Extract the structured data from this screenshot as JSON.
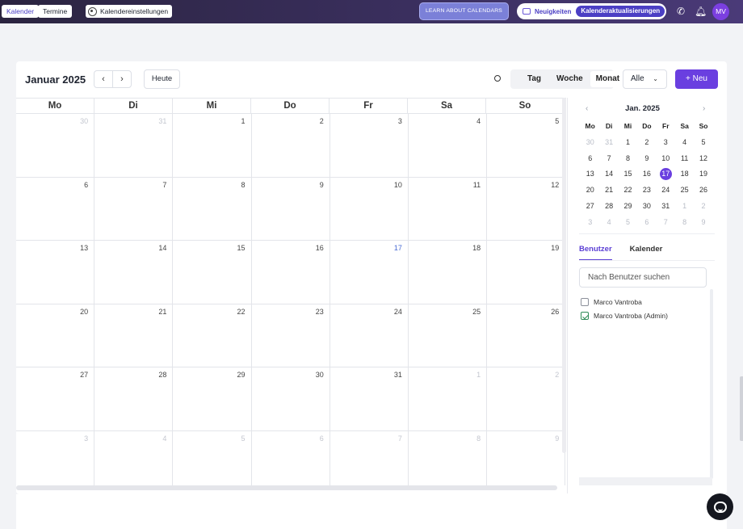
{
  "topbar": {
    "tabs": [
      {
        "label": "Kalender",
        "active": true
      },
      {
        "label": "Termine",
        "active": false
      }
    ],
    "settings_label": "Kalendereinstellungen",
    "learn_label": "LEARN ABOUT CALENDARS",
    "news_label": "Neuigkeiten",
    "updates_label": "Kalenderaktualisierungen",
    "avatar_initials": "MV",
    "icons": [
      "gear-icon",
      "megaphone-icon",
      "phone-icon",
      "bell-icon"
    ]
  },
  "toolbar": {
    "month_title": "Januar 2025",
    "prev_label": "‹",
    "next_label": "›",
    "today_label": "Heute",
    "views": [
      "Tag",
      "Woche",
      "Monat"
    ],
    "active_view": "Monat",
    "filter_value": "Alle",
    "new_label": "+ Neu"
  },
  "calendar": {
    "weekdays": [
      "Mo",
      "Di",
      "Mi",
      "Do",
      "Fr",
      "Sa",
      "So"
    ],
    "weeks": [
      [
        {
          "d": "30",
          "m": true
        },
        {
          "d": "31",
          "m": true
        },
        {
          "d": "1"
        },
        {
          "d": "2"
        },
        {
          "d": "3"
        },
        {
          "d": "4"
        },
        {
          "d": "5"
        }
      ],
      [
        {
          "d": "6"
        },
        {
          "d": "7"
        },
        {
          "d": "8"
        },
        {
          "d": "9"
        },
        {
          "d": "10"
        },
        {
          "d": "11"
        },
        {
          "d": "12"
        }
      ],
      [
        {
          "d": "13"
        },
        {
          "d": "14"
        },
        {
          "d": "15"
        },
        {
          "d": "16"
        },
        {
          "d": "17",
          "today": true
        },
        {
          "d": "18"
        },
        {
          "d": "19"
        }
      ],
      [
        {
          "d": "20"
        },
        {
          "d": "21"
        },
        {
          "d": "22"
        },
        {
          "d": "23"
        },
        {
          "d": "24"
        },
        {
          "d": "25"
        },
        {
          "d": "26"
        }
      ],
      [
        {
          "d": "27"
        },
        {
          "d": "28"
        },
        {
          "d": "29"
        },
        {
          "d": "30"
        },
        {
          "d": "31"
        },
        {
          "d": "1",
          "m": true
        },
        {
          "d": "2",
          "m": true
        }
      ],
      [
        {
          "d": "3",
          "m": true
        },
        {
          "d": "4",
          "m": true
        },
        {
          "d": "5",
          "m": true
        },
        {
          "d": "6",
          "m": true
        },
        {
          "d": "7",
          "m": true
        },
        {
          "d": "8",
          "m": true
        },
        {
          "d": "9",
          "m": true
        }
      ]
    ]
  },
  "mini_calendar": {
    "title": "Jan. 2025",
    "prev_label": "‹",
    "next_label": "›",
    "weekdays": [
      "Mo",
      "Di",
      "Mi",
      "Do",
      "Fr",
      "Sa",
      "So"
    ],
    "weeks": [
      [
        {
          "d": "30",
          "m": true
        },
        {
          "d": "31",
          "m": true
        },
        {
          "d": "1"
        },
        {
          "d": "2"
        },
        {
          "d": "3"
        },
        {
          "d": "4"
        },
        {
          "d": "5"
        }
      ],
      [
        {
          "d": "6"
        },
        {
          "d": "7"
        },
        {
          "d": "8"
        },
        {
          "d": "9"
        },
        {
          "d": "10"
        },
        {
          "d": "11"
        },
        {
          "d": "12"
        }
      ],
      [
        {
          "d": "13"
        },
        {
          "d": "14"
        },
        {
          "d": "15"
        },
        {
          "d": "16"
        },
        {
          "d": "17",
          "sel": true
        },
        {
          "d": "18"
        },
        {
          "d": "19"
        }
      ],
      [
        {
          "d": "20"
        },
        {
          "d": "21"
        },
        {
          "d": "22"
        },
        {
          "d": "23"
        },
        {
          "d": "24"
        },
        {
          "d": "25"
        },
        {
          "d": "26"
        }
      ],
      [
        {
          "d": "27"
        },
        {
          "d": "28"
        },
        {
          "d": "29"
        },
        {
          "d": "30"
        },
        {
          "d": "31"
        },
        {
          "d": "1",
          "m": true
        },
        {
          "d": "2",
          "m": true
        }
      ],
      [
        {
          "d": "3",
          "m": true
        },
        {
          "d": "4",
          "m": true
        },
        {
          "d": "5",
          "m": true
        },
        {
          "d": "6",
          "m": true
        },
        {
          "d": "7",
          "m": true
        },
        {
          "d": "8",
          "m": true
        },
        {
          "d": "9",
          "m": true
        }
      ]
    ]
  },
  "sidebar": {
    "tabs": [
      "Benutzer",
      "Kalender"
    ],
    "active_tab": "Benutzer",
    "search_placeholder": "Nach Benutzer suchen",
    "users": [
      {
        "name": "Marco Vantroba",
        "checked": false
      },
      {
        "name": "Marco Vantroba (Admin)",
        "checked": true
      }
    ]
  },
  "colors": {
    "accent": "#6a3fe0",
    "today_text": "#4a6cd4",
    "check": "#2e8b57"
  }
}
